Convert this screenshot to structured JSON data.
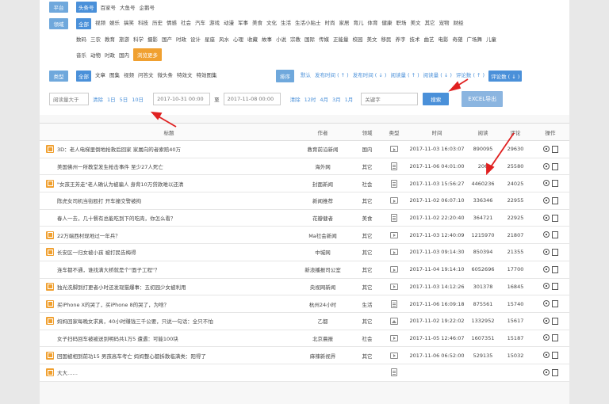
{
  "filters": {
    "platform": {
      "label": "平台",
      "options": [
        "头条号",
        "百家号",
        "大鱼号",
        "企鹅号"
      ]
    },
    "domain": {
      "label": "领域",
      "row1": [
        "全部",
        "视频",
        "娱乐",
        "搞笑",
        "科技",
        "历史",
        "情感",
        "社会",
        "汽车",
        "游戏",
        "动漫",
        "军事",
        "美食",
        "文化",
        "生活",
        "生活小贴士",
        "时尚",
        "家居",
        "育儿",
        "体育",
        "健康",
        "职场",
        "美文",
        "其它",
        "宠物",
        "财经"
      ],
      "row2": [
        "数码",
        "三农",
        "教育",
        "旅游",
        "科学",
        "摄影",
        "国产",
        "时政",
        "设计",
        "星座",
        "风水",
        "心理",
        "收藏",
        "故事",
        "小说",
        "宗教",
        "国际",
        "传媒",
        "正能量",
        "校园",
        "美文",
        "移民",
        "养字",
        "技术",
        "曲艺",
        "电影",
        "奇葩",
        "广场舞",
        "儿童"
      ],
      "row3": [
        "音乐",
        "动物",
        "时政",
        "国内"
      ],
      "action": "浏览更多"
    },
    "type": {
      "label": "类型",
      "options": [
        "全部",
        "文章",
        "图集",
        "视频",
        "问答文",
        "微头条",
        "特效文",
        "特效图集"
      ]
    },
    "sort": {
      "label": "排序",
      "options": [
        "默认",
        "发布时间 ( ↑ )",
        "发布时间 ( ↓ )",
        "阅读量 ( ↑ )",
        "阅读量 ( ↓ )",
        "评论数 ( ↑ )",
        "评论数 ( ↓ )"
      ]
    },
    "read_min": {
      "placeholder": "阅读量大于"
    },
    "days": [
      "清除",
      "1日",
      "5日",
      "10日"
    ],
    "date_from": "2017-10-31 00:00",
    "date_sep": "至",
    "date_to": "2017-11-08 00:00",
    "hours": [
      "清除",
      "12时",
      "4月",
      "3月",
      "1月"
    ],
    "keyword": {
      "placeholder": "关键字"
    },
    "search_label": "搜索",
    "excel_label": "EXCEL导出"
  },
  "table": {
    "headers": [
      "标题",
      "作者",
      "领域",
      "类型",
      "时间",
      "阅读",
      "评论",
      "操作"
    ],
    "rows": [
      {
        "mark": true,
        "title": "3D：老人电梯里倒地抢救后回家 家属向的者索赔40万",
        "author": "教育前沿新闻",
        "domain": "国内",
        "type": "video",
        "time": "2017-11-03 16:03:07",
        "reads": "890095",
        "comments": "29630"
      },
      {
        "mark": false,
        "title": "美国佛州一所教堂发生枪击事件 至少27人死亡",
        "author": "海外网",
        "domain": "其它",
        "type": "doc",
        "time": "2017-11-06 04:01:00",
        "reads": "206",
        "comments": "25580"
      },
      {
        "mark": true,
        "title": "\"女孩王芳走\"老人确认为被骗人 身背10万贷款难以还清",
        "author": "封面新闻",
        "domain": "社会",
        "type": "doc",
        "time": "2017-11-03 15:56:27",
        "reads": "4460236",
        "comments": "24025"
      },
      {
        "mark": false,
        "title": "陈虎女司机当街殴打 开车撞交警被拘",
        "author": "新闻推荐",
        "domain": "其它",
        "type": "video",
        "time": "2017-11-02 06:07:10",
        "reads": "336346",
        "comments": "22955"
      },
      {
        "mark": false,
        "title": "春人一去，几十餐有总能吃到下的吃肉，你怎么看？",
        "author": "花瓣健者",
        "domain": "美食",
        "type": "doc",
        "time": "2017-11-02 22:20:40",
        "reads": "364721",
        "comments": "22925"
      },
      {
        "mark": true,
        "title": "22万端西村现地过一年兵？",
        "author": "Ma社会新闻",
        "domain": "其它",
        "type": "video",
        "time": "2017-11-03 12:40:09",
        "reads": "1215970",
        "comments": "21807"
      },
      {
        "mark": true,
        "title": "长安区一归女被小孩 被打民告梅得",
        "author": "中城网",
        "domain": "其它",
        "type": "video",
        "time": "2017-11-03 09:14:30",
        "reads": "850394",
        "comments": "21355"
      },
      {
        "mark": false,
        "title": "连车都不通，谁找满大桥就是个\"面子工程\"？",
        "author": "新浪播报司公室",
        "domain": "其它",
        "type": "video",
        "time": "2017-11-04 19:14:10",
        "reads": "6052696",
        "comments": "17700"
      },
      {
        "mark": true,
        "title": "独光洗脚到打更者小时还发现猫爆事：五初园少女被利用",
        "author": "央视网新闻",
        "domain": "其它",
        "type": "video",
        "time": "2017-11-03 14:12:26",
        "reads": "301378",
        "comments": "16845"
      },
      {
        "mark": true,
        "title": "买iPhone X的哭了，买iPhone 8的哭了，为啥？",
        "author": "杭州24小时",
        "domain": "生活",
        "type": "doc",
        "time": "2017-11-06 16:09:18",
        "reads": "875561",
        "comments": "15740"
      },
      {
        "mark": true,
        "title": "妈妈回家每晚女求真，40小时赚钱三千公要，只说一句话：全只不怕",
        "author": "乙都",
        "domain": "其它",
        "type": "img",
        "time": "2017-11-02 19:22:02",
        "reads": "1332952",
        "comments": "15617"
      },
      {
        "mark": false,
        "title": "女子扫码回车被被送到明码共1万5 遭遇：可能100块",
        "author": "北京晨报",
        "domain": "社会",
        "type": "video",
        "time": "2017-11-05 12:46:07",
        "reads": "1607351",
        "comments": "15187"
      },
      {
        "mark": true,
        "title": "回国被相到前功15 男孩高车考亡 妈妈整心都拆散临满类：阳得了",
        "author": "麻辣新视界",
        "domain": "其它",
        "type": "video",
        "time": "2017-11-06 06:52:00",
        "reads": "529135",
        "comments": "15032"
      },
      {
        "mark": true,
        "title": "大大……",
        "author": "",
        "domain": "",
        "type": "doc",
        "time": "",
        "reads": "",
        "comments": ""
      }
    ]
  }
}
